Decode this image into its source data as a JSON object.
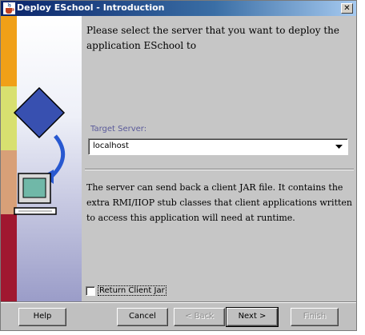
{
  "window": {
    "title": "Deploy ESchool - Introduction",
    "close_label": "✕",
    "title_icon": "java-cup-icon",
    "titlebar_color": "#0a246a",
    "background_color": "#c0c0c0"
  },
  "side_panel": {
    "stripe_colors": [
      "#f0a018",
      "#d8e070",
      "#d8a078",
      "#a01830"
    ],
    "illustration": "deploy-to-computer-illustration"
  },
  "main": {
    "intro_text": "Please select the server that you want to deploy the application ESchool to",
    "target_server_label": "Target Server:",
    "target_server_value": "localhost",
    "info_text": "The server can send back a client JAR file. It contains the extra RMI/IIOP stub classes that client applications written to access this application will need at runtime.",
    "return_client_jar_label": "Return Client Jar",
    "return_client_jar_checked": false
  },
  "footer": {
    "help_label": "Help",
    "cancel_label": "Cancel",
    "back_label": "< Back",
    "next_label": "Next >",
    "finish_label": "Finish"
  }
}
